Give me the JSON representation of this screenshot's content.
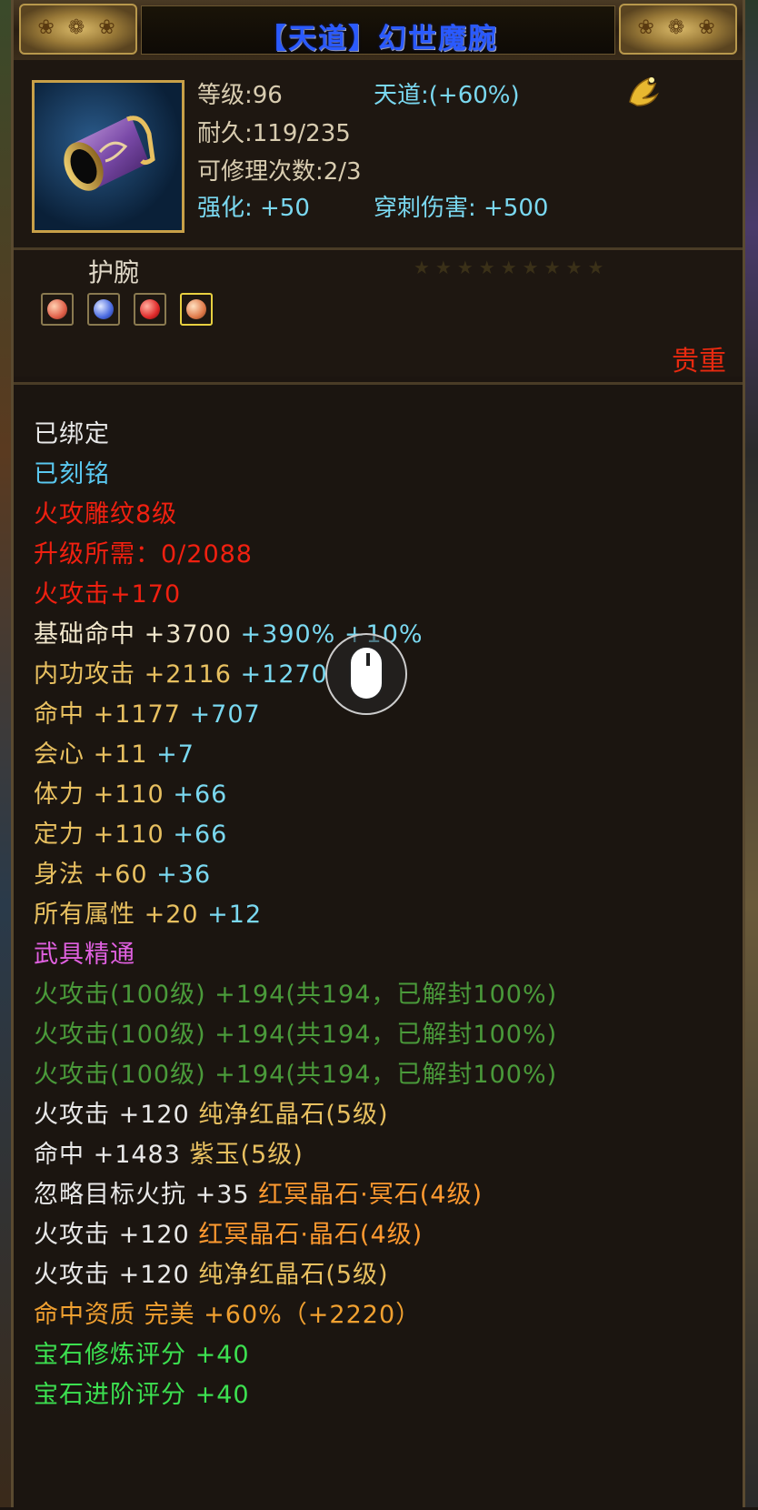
{
  "title": {
    "prefix": "【天道】",
    "name": "幻世魔腕"
  },
  "header": {
    "level": "等级:96",
    "tiandao": "天道:(+60%)",
    "durability": "耐久:119/235",
    "repair": "可修理次数:2/3",
    "enhance": "强化: +50",
    "pierce": "穿刺伤害: +500"
  },
  "type": {
    "label": "护腕",
    "precious": "贵重",
    "stars": "★★★★★★★★★"
  },
  "colors": {
    "title_blue": "#2a5aff",
    "border_gold": "#c8a048"
  },
  "gems": [
    {
      "color": "#e0604a",
      "selected": false
    },
    {
      "color": "#4a6ae0",
      "selected": false
    },
    {
      "color": "#e02a2a",
      "selected": false
    },
    {
      "color": "#e07a4a",
      "selected": true
    }
  ],
  "attrs": {
    "bound": "已绑定",
    "engraved": "已刻铭",
    "fire_tattoo": "火攻雕纹8级",
    "upgrade_req": "升级所需：0/2088",
    "fire_attack": "火攻击+170",
    "base_hit_label": "基础命中 +3700",
    "base_hit_bonus": "+390% +10%",
    "inner_atk_label": "内功攻击 +2116",
    "inner_atk_bonus": "+1270",
    "hit_label": "命中 +1177",
    "hit_bonus": "+707",
    "crit_label": "会心 +11",
    "crit_bonus": "+7",
    "stamina_label": "体力 +110",
    "stamina_bonus": "+66",
    "focus_label": "定力 +110",
    "focus_bonus": "+66",
    "agility_label": "身法 +60",
    "agility_bonus": "+36",
    "allattr_label": "所有属性 +20",
    "allattr_bonus": "+12",
    "mastery": "武具精通",
    "mastery_1": "火攻击(100级) +194(共194，已解封100%)",
    "mastery_2": "火攻击(100级) +194(共194，已解封100%)",
    "mastery_3": "火攻击(100级) +194(共194，已解封100%)",
    "gem1_stat": "火攻击 +120",
    "gem1_name": "纯净红晶石(5级)",
    "gem2_stat": "命中 +1483",
    "gem2_name": "紫玉(5级)",
    "gem3_stat": "忽略目标火抗 +35",
    "gem3_name": "红冥晶石·冥石(4级)",
    "gem4_stat": "火攻击 +120",
    "gem4_name": "红冥晶石·晶石(4级)",
    "gem5_stat": "火攻击 +120",
    "gem5_name": "纯净红晶石(5级)",
    "aptitude": "命中资质  完美 +60%（+2220）",
    "gem_refine": "宝石修炼评分 +40",
    "gem_advance": "宝石进阶评分 +40"
  }
}
